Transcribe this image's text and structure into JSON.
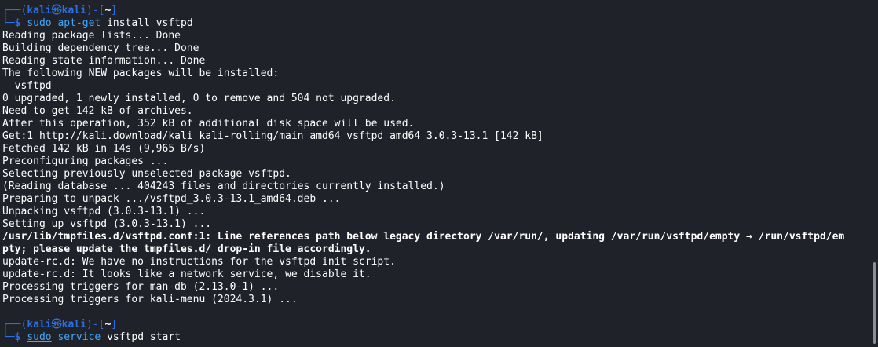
{
  "prompts": [
    {
      "frame_top_left": "┌──(",
      "user": "kali",
      "at": "㉿",
      "host": "kali",
      "frame_mid": ")-[",
      "cwd": "~",
      "frame_close": "]",
      "frame_bottom": "└─",
      "dollar": "$",
      "sudo": "sudo",
      "program": "apt-get",
      "args": "install vsftpd"
    },
    {
      "frame_top_left": "┌──(",
      "user": "kali",
      "at": "㉿",
      "host": "kali",
      "frame_mid": ")-[",
      "cwd": "~",
      "frame_close": "]",
      "frame_bottom": "└─",
      "dollar": "$",
      "sudo": "sudo",
      "program": "service",
      "args": "vsftpd start"
    }
  ],
  "output": [
    "Reading package lists... Done",
    "Building dependency tree... Done",
    "Reading state information... Done",
    "The following NEW packages will be installed:",
    "  vsftpd",
    "0 upgraded, 1 newly installed, 0 to remove and 504 not upgraded.",
    "Need to get 142 kB of archives.",
    "After this operation, 352 kB of additional disk space will be used.",
    "Get:1 http://kali.download/kali kali-rolling/main amd64 vsftpd amd64 3.0.3-13.1 [142 kB]",
    "Fetched 142 kB in 14s (9,965 B/s)",
    "Preconfiguring packages ...",
    "Selecting previously unselected package vsftpd.",
    "(Reading database ... 404243 files and directories currently installed.)",
    "Preparing to unpack .../vsftpd_3.0.3-13.1_amd64.deb ...",
    "Unpacking vsftpd (3.0.3-13.1) ...",
    "Setting up vsftpd (3.0.3-13.1) ...",
    "/usr/lib/tmpfiles.d/vsftpd.conf:1: Line references path below legacy directory /var/run/, updating /var/run/vsftpd/empty → /run/vsftpd/em",
    "pty; please update the tmpfiles.d/ drop-in file accordingly.",
    "update-rc.d: We have no instructions for the vsftpd init script.",
    "update-rc.d: It looks like a network service, we disable it.",
    "Processing triggers for man-db (2.13.0-1) ...",
    "Processing triggers for kali-menu (2024.3.1) ..."
  ],
  "colors": {
    "background": "#1f2229",
    "prompt_blue": "#2a6ee0",
    "command_blue": "#3fa7ff",
    "text": "#ffffff"
  }
}
